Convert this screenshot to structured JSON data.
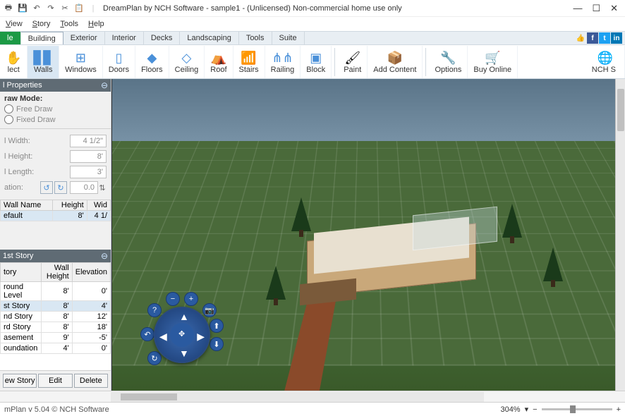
{
  "titlebar": {
    "title": "DreamPlan by NCH Software - sample1 - (Unlicensed) Non-commercial home use only"
  },
  "menubar": {
    "view": "View",
    "story": "Story",
    "tools": "Tools",
    "help": "Help"
  },
  "tabs": {
    "file": "le",
    "building": "Building",
    "exterior": "Exterior",
    "interior": "Interior",
    "decks": "Decks",
    "landscaping": "Landscaping",
    "tools": "Tools",
    "suite": "Suite"
  },
  "ribbon": {
    "select": "lect",
    "walls": "Walls",
    "windows": "Windows",
    "doors": "Doors",
    "floors": "Floors",
    "ceiling": "Ceiling",
    "roof": "Roof",
    "stairs": "Stairs",
    "railing": "Railing",
    "block": "Block",
    "paint": "Paint",
    "add_content": "Add Content",
    "options": "Options",
    "buy_online": "Buy Online",
    "nch": "NCH S"
  },
  "props": {
    "panel_title": "l Properties",
    "draw_mode_label": "raw Mode:",
    "free_draw": "Free Draw",
    "fixed_draw": "Fixed Draw",
    "width_label": "l Width:",
    "width_val": "4 1/2\"",
    "height_label": "l Height:",
    "height_val": "8'",
    "length_label": "l Length:",
    "length_val": "3'",
    "rotation_label": "ation:",
    "rotation_val": "0.0",
    "table": {
      "h1": "Wall Name",
      "h2": "Height",
      "h3": "Wid",
      "r1c1": "efault",
      "r1c2": "8'",
      "r1c3": "4 1/"
    }
  },
  "story": {
    "panel_title": "1st Story",
    "table": {
      "h1": "tory",
      "h2": "Wall Height",
      "h3": "Elevation",
      "rows": [
        {
          "c1": "round Level",
          "c2": "8'",
          "c3": "0'"
        },
        {
          "c1": "st Story",
          "c2": "8'",
          "c3": "4'"
        },
        {
          "c1": "nd Story",
          "c2": "8'",
          "c3": "12'"
        },
        {
          "c1": "rd Story",
          "c2": "8'",
          "c3": "18'"
        },
        {
          "c1": "asement",
          "c2": "9'",
          "c3": "-5'"
        },
        {
          "c1": "oundation",
          "c2": "4'",
          "c3": "0'"
        }
      ]
    },
    "btn_new": "ew Story",
    "btn_edit": "Edit",
    "btn_delete": "Delete"
  },
  "status": {
    "version": "mPlan v 5.04 © NCH Software",
    "zoom": "304%"
  }
}
